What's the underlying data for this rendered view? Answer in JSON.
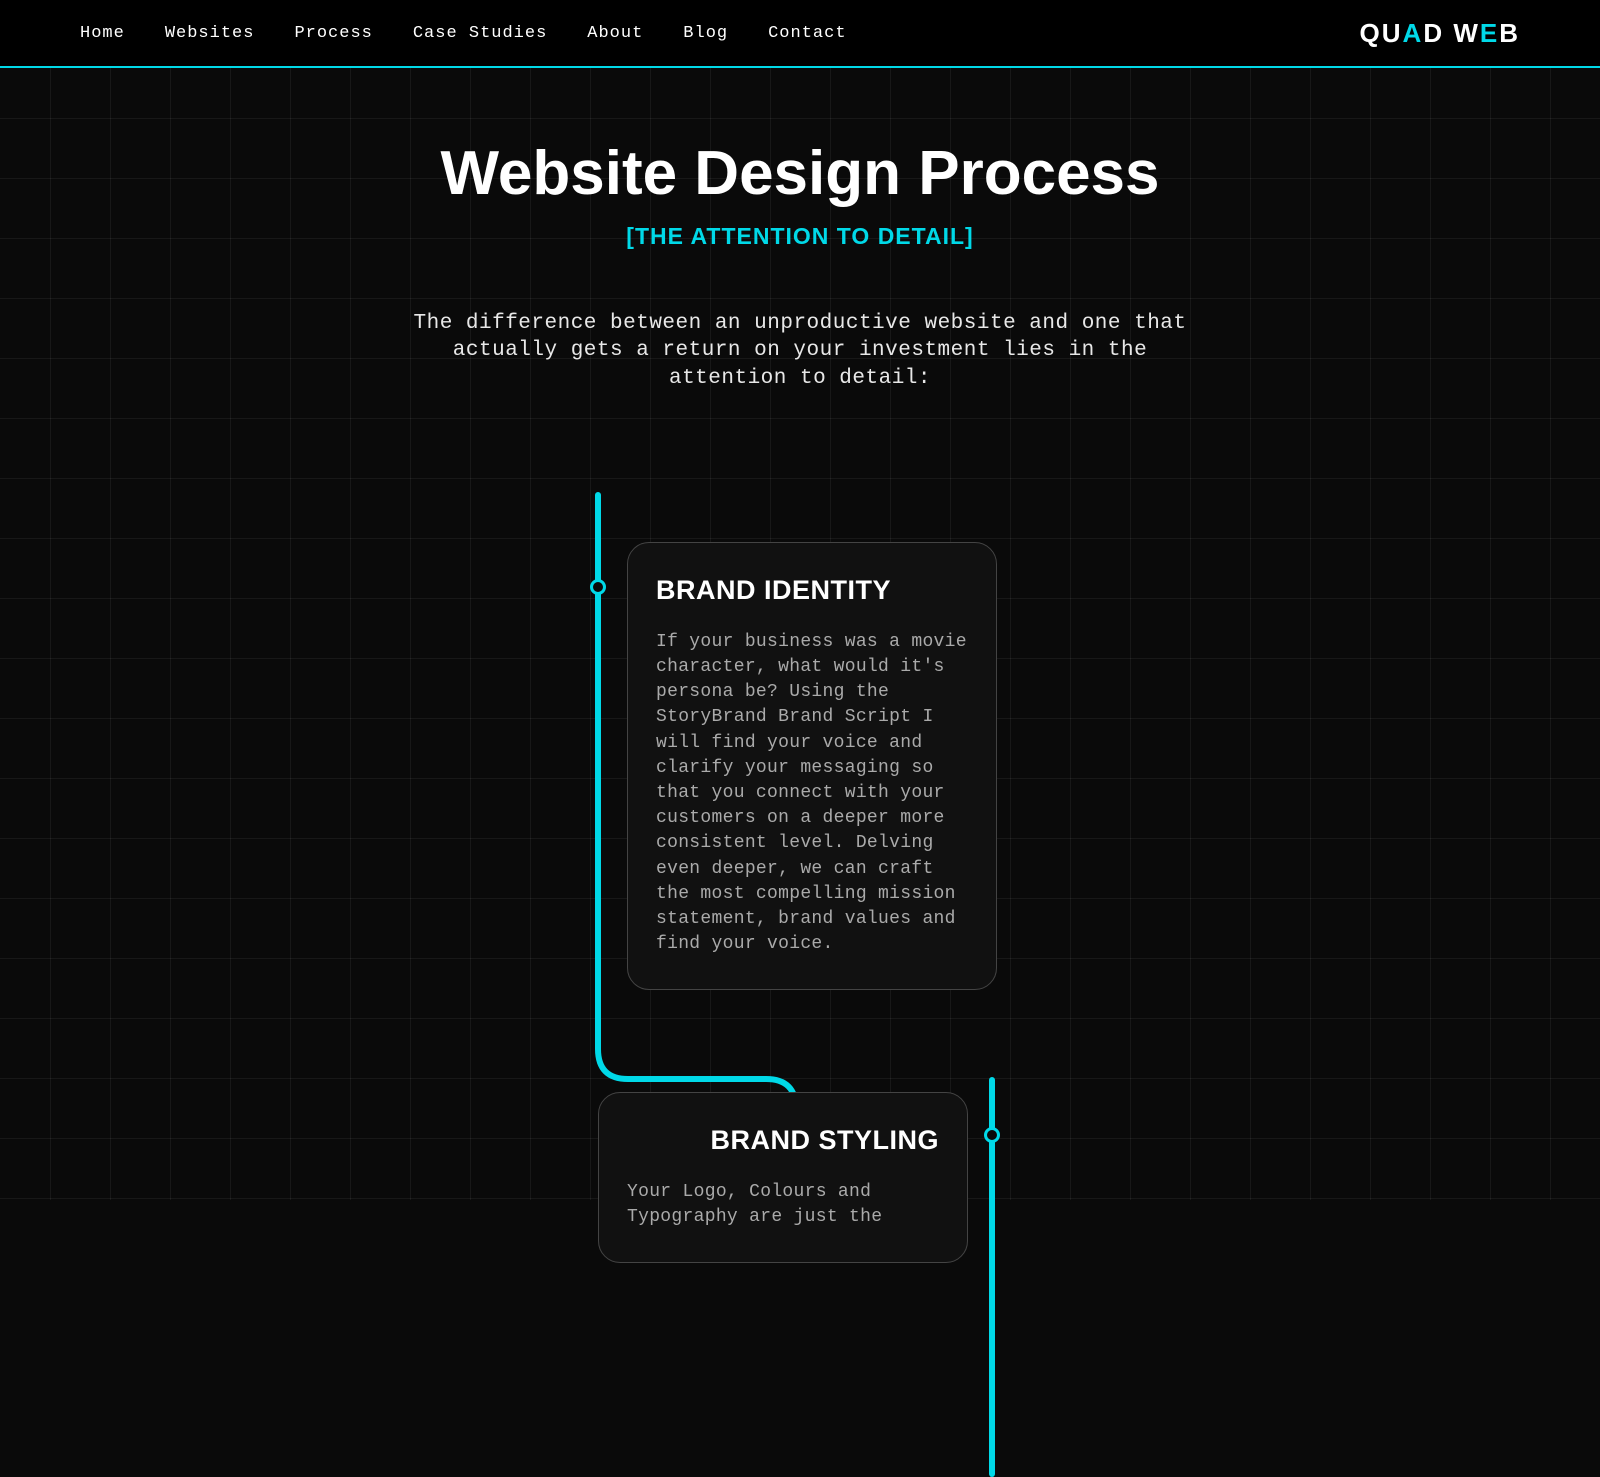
{
  "nav": {
    "items": [
      "Home",
      "Websites",
      "Process",
      "Case Studies",
      "About",
      "Blog",
      "Contact"
    ],
    "logo_a": "QU",
    "logo_b": "A",
    "logo_c": "D W",
    "logo_d": "E",
    "logo_e": "B"
  },
  "hero": {
    "title": "Website Design Process",
    "subtitle": "[THE ATTENTION TO DETAIL]",
    "intro": "The difference between an unproductive website and one that actually gets a return on your investment lies in the attention to detail:"
  },
  "cards": [
    {
      "title": "BRAND IDENTITY",
      "body": "If your business was a movie character, what would it's persona be? Using the StoryBrand Brand Script I will find your voice and clarify your messaging so that you connect with your customers on a deeper more consistent level. Delving even deeper, we can craft the most compelling mission statement, brand values and find your voice."
    },
    {
      "title": "BRAND STYLING",
      "body": "Your Logo, Colours and Typography are just the"
    }
  ],
  "colors": {
    "accent": "#00d9e8",
    "bg": "#0a0a0a"
  }
}
